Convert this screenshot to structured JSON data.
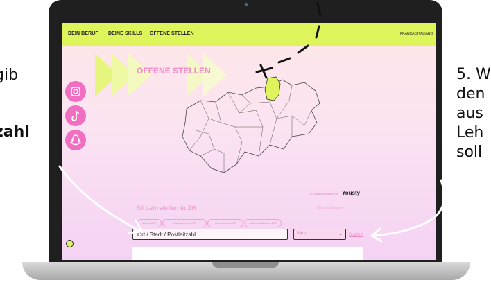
{
  "left_caption": {
    "line1": "gib",
    "line2": "zahl"
  },
  "right_caption": {
    "lines": [
      "5. W",
      "den",
      "aus",
      "Leh",
      "soll"
    ]
  },
  "navbar": {
    "links": [
      "DEIN BERUF",
      "DEINE SKILLS",
      "OFFENE STELLEN"
    ],
    "languages": [
      "FRANÇAIS",
      "ITALIANO"
    ]
  },
  "page": {
    "heading": "OFFENE STELLEN",
    "partner_text": "In Zusammenarbeit mit",
    "partner_logo": "Yousty",
    "results_title": "50 Lehrstellen in ZH",
    "filter_link": "Filter schliessen",
    "filter_chips": [
      "Maler/in EFZ",
      "Kaufmann/-frau EFZ",
      "Informatiker/in EFZ",
      "Elektroinstallateur/in EFZ"
    ],
    "location_input": {
      "value": "Ort / Stadt / Postleitzahl"
    },
    "radius_select": {
      "value": "5 km"
    },
    "search_link": "Suchen"
  },
  "social_icons": [
    "instagram-icon",
    "tiktok-icon",
    "snapchat-icon"
  ],
  "colors": {
    "navbar": "#dff35a",
    "accent_pink": "#f06fc0",
    "highlight_canton": "#dff35a"
  }
}
